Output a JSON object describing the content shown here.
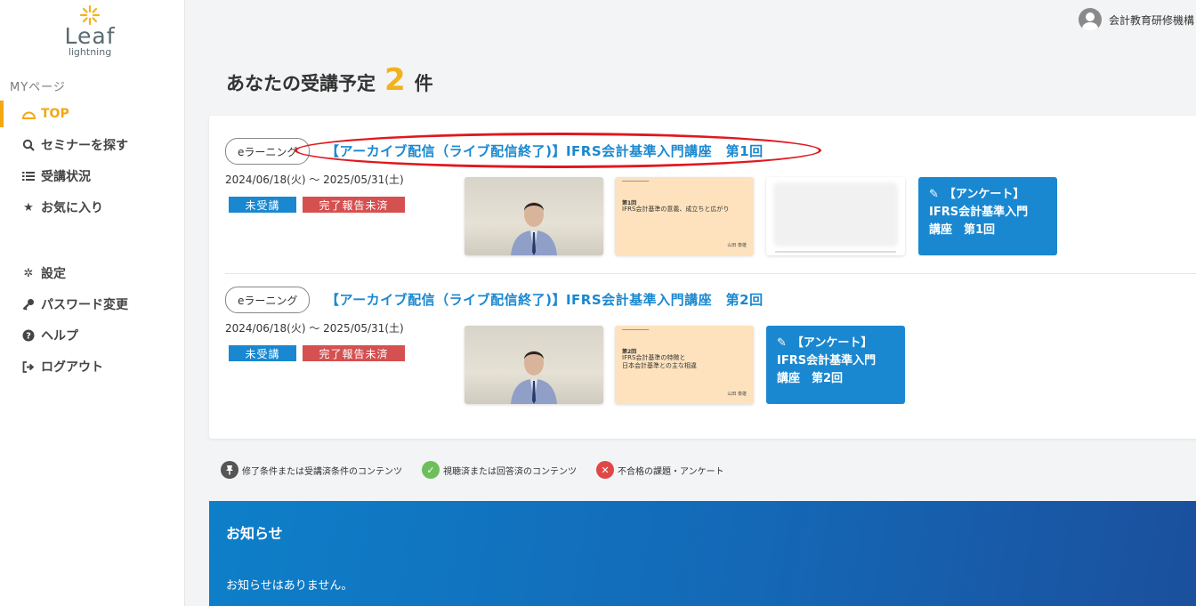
{
  "brand": {
    "logo_main": "Leaf",
    "logo_sub": "lightning"
  },
  "sidebar": {
    "section_label": "MYページ",
    "items": [
      {
        "label": "TOP",
        "icon": "top-icon"
      },
      {
        "label": "セミナーを探す",
        "icon": "search-icon"
      },
      {
        "label": "受講状況",
        "icon": "list-icon"
      },
      {
        "label": "お気に入り",
        "icon": "star-icon"
      },
      {
        "label": "設定",
        "icon": "gear-icon"
      },
      {
        "label": "パスワード変更",
        "icon": "key-icon"
      },
      {
        "label": "ヘルプ",
        "icon": "help-icon"
      },
      {
        "label": "ログアウト",
        "icon": "logout-icon"
      }
    ]
  },
  "user": {
    "name": "会計教育研修機構"
  },
  "heading": {
    "prefix": "あなたの受講予定",
    "count": "2",
    "suffix": "件"
  },
  "courses": [
    {
      "tag": "eラーニング",
      "title": "【アーカイブ配信（ライブ配信終了)】IFRS会計基準入門講座　第1回",
      "date": "2024/06/18(火) ～ 2025/05/31(土)",
      "status_a": "未受講",
      "status_b": "完了報告未済",
      "slide": {
        "no": "第1回",
        "text": "IFRS会計基準の意義、成立ちと広がり",
        "foot": "山田 泰雄"
      },
      "survey": {
        "line1": "【アンケート】",
        "line2": "IFRS会計基準入門",
        "line3": "講座　第1回"
      }
    },
    {
      "tag": "eラーニング",
      "title": "【アーカイブ配信（ライブ配信終了)】IFRS会計基準入門講座　第2回",
      "date": "2024/06/18(火) ～ 2025/05/31(土)",
      "status_a": "未受講",
      "status_b": "完了報告未済",
      "slide": {
        "no": "第2回",
        "text": "IFRS会計基準の特徴と",
        "text2": "日本会計基準との主な相違",
        "foot": "山田 泰雄"
      },
      "survey": {
        "line1": "【アンケート】",
        "line2": "IFRS会計基準入門",
        "line3": "講座　第2回"
      }
    }
  ],
  "legend": [
    {
      "label": "修了条件または受講済条件のコンテンツ",
      "icon": "pin-icon",
      "color": "#555555"
    },
    {
      "label": "視聴済または回答済のコンテンツ",
      "icon": "check-icon",
      "color": "#6cbf5a"
    },
    {
      "label": "不合格の課題・アンケート",
      "icon": "cross-icon",
      "color": "#e04848"
    }
  ],
  "notice": {
    "title": "お知らせ",
    "body": "お知らせはありません。"
  },
  "colors": {
    "accent": "#f3a712",
    "link": "#1a88d0",
    "danger": "#d55050"
  }
}
